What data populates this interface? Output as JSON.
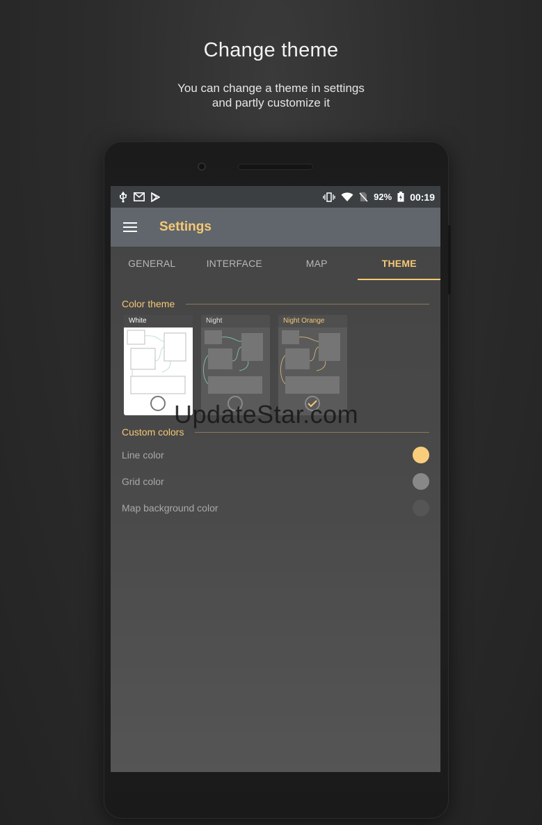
{
  "promo": {
    "title": "Change theme",
    "subtitle_line1": "You can change a theme in settings",
    "subtitle_line2": "and partly customize it"
  },
  "status_bar": {
    "battery_percent": "92%",
    "time": "00:19",
    "left_icons": [
      "usb-icon",
      "mail-icon",
      "play-store-icon"
    ],
    "right_icons": [
      "vibrate-icon",
      "wifi-icon",
      "no-sim-icon",
      "battery-icon"
    ]
  },
  "app_bar": {
    "title": "Settings",
    "menu_icon": "hamburger-icon"
  },
  "tabs": [
    {
      "label": "GENERAL",
      "active": false
    },
    {
      "label": "INTERFACE",
      "active": false
    },
    {
      "label": "MAP",
      "active": false
    },
    {
      "label": "THEME",
      "active": true
    }
  ],
  "color_theme": {
    "header": "Color theme",
    "options": [
      {
        "label": "White",
        "selected": false
      },
      {
        "label": "Night",
        "selected": false
      },
      {
        "label": "Night Orange",
        "selected": true
      }
    ]
  },
  "custom_colors": {
    "header": "Custom colors",
    "items": [
      {
        "label": "Line color",
        "color": "#f9cd7c"
      },
      {
        "label": "Grid color",
        "color": "#888888"
      },
      {
        "label": "Map background color",
        "color": "#555555"
      }
    ]
  },
  "colors": {
    "accent": "#f6c875",
    "app_bar": "#60666b",
    "screen_bg": "#4a4a4a"
  },
  "watermark": "UpdateStar.com"
}
